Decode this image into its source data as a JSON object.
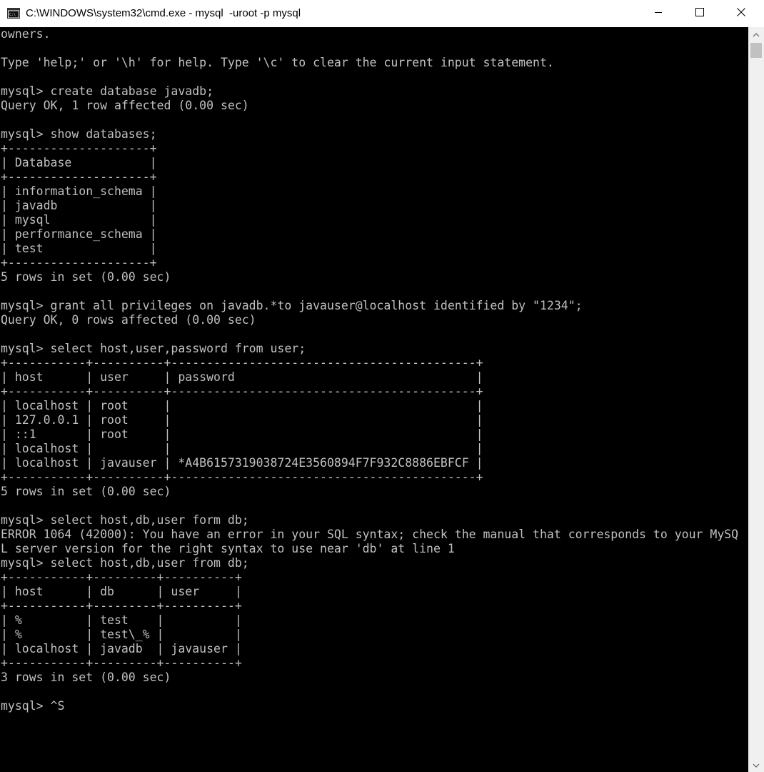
{
  "window": {
    "title": "C:\\WINDOWS\\system32\\cmd.exe - mysql  -uroot -p mysql",
    "app_icon": "cmd-icon",
    "controls": {
      "minimize_icon": "minimize-icon",
      "maximize_icon": "maximize-icon",
      "close_icon": "close-icon"
    }
  },
  "console": {
    "lines": [
      "owners.",
      "",
      "Type 'help;' or '\\h' for help. Type '\\c' to clear the current input statement.",
      "",
      "mysql> create database javadb;",
      "Query OK, 1 row affected (0.00 sec)",
      "",
      "mysql> show databases;",
      "+--------------------+",
      "| Database           |",
      "+--------------------+",
      "| information_schema |",
      "| javadb             |",
      "| mysql              |",
      "| performance_schema |",
      "| test               |",
      "+--------------------+",
      "5 rows in set (0.00 sec)",
      "",
      "mysql> grant all privileges on javadb.*to javauser@localhost identified by \"1234\";",
      "Query OK, 0 rows affected (0.00 sec)",
      "",
      "mysql> select host,user,password from user;",
      "+-----------+----------+-------------------------------------------+",
      "| host      | user     | password                                  |",
      "+-----------+----------+-------------------------------------------+",
      "| localhost | root     |                                           |",
      "| 127.0.0.1 | root     |                                           |",
      "| ::1       | root     |                                           |",
      "| localhost |          |                                           |",
      "| localhost | javauser | *A4B6157319038724E3560894F7F932C8886EBFCF |",
      "+-----------+----------+-------------------------------------------+",
      "5 rows in set (0.00 sec)",
      "",
      "mysql> select host,db,user form db;",
      "ERROR 1064 (42000): You have an error in your SQL syntax; check the manual that corresponds to your MySQ",
      "L server version for the right syntax to use near 'db' at line 1",
      "mysql> select host,db,user from db;",
      "+-----------+---------+----------+",
      "| host      | db      | user     |",
      "+-----------+---------+----------+",
      "| %         | test    |          |",
      "| %         | test\\_% |          |",
      "| localhost | javadb  | javauser |",
      "+-----------+---------+----------+",
      "3 rows in set (0.00 sec)",
      "",
      "mysql> ^S"
    ]
  },
  "scrollbar": {
    "up_icon": "scroll-up-arrow-icon",
    "down_icon": "scroll-down-arrow-icon"
  },
  "colors": {
    "console_background": "#000000",
    "console_text": "#c0c0c0",
    "titlebar_background": "#ffffff",
    "scrollbar_track": "#f0f0f0",
    "scrollbar_thumb": "#c1c1c1"
  }
}
